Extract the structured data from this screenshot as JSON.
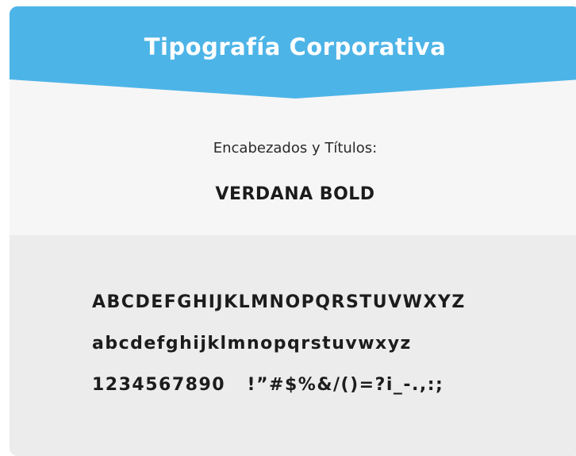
{
  "header": {
    "title": "Tipografía Corporativa",
    "color": "#4db4e7"
  },
  "section": {
    "subtitle": "Encabezados y Títulos:",
    "font_name": "VERDANA BOLD"
  },
  "specimen": {
    "uppercase": "ABCDEFGHIJKLMNOPQRSTUVWXYZ",
    "lowercase": "abcdefghijklmnopqrstuvwxyz",
    "digits_symbols": "1234567890   !”#$%&/()=?i_-.,:;"
  },
  "colors": {
    "top_background": "#f6f6f6",
    "bottom_background": "#ececec",
    "text": "#1c1c1c"
  }
}
